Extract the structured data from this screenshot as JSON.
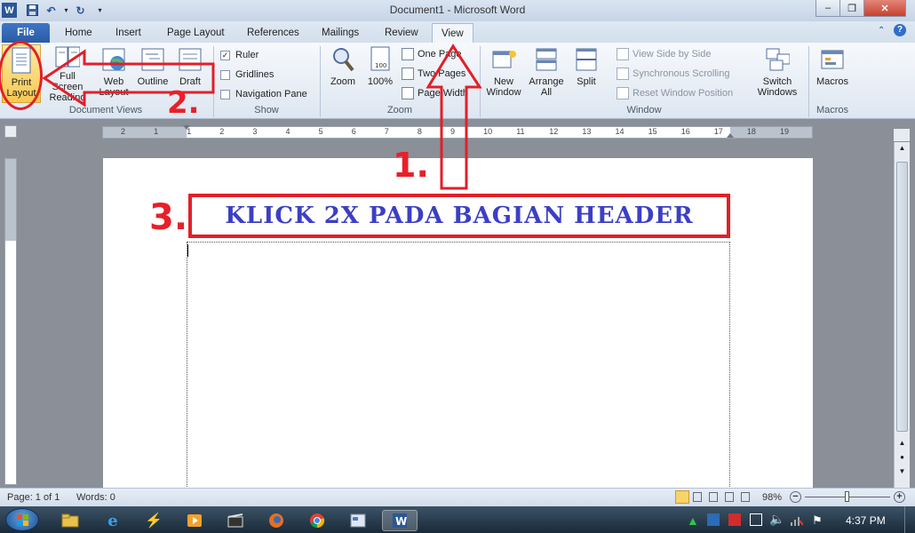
{
  "window": {
    "title": "Document1  -  Microsoft Word",
    "minimize": "–",
    "maximize": "❐",
    "close": "✕"
  },
  "tabs": [
    "File",
    "Home",
    "Insert",
    "Page Layout",
    "References",
    "Mailings",
    "Review",
    "View"
  ],
  "ribbon": {
    "document_views": {
      "label": "Document Views",
      "print_layout": "Print Layout",
      "full_screen": "Full Screen Reading",
      "web_layout": "Web Layout",
      "outline": "Outline",
      "draft": "Draft"
    },
    "show": {
      "label": "Show",
      "ruler": "Ruler",
      "gridlines": "Gridlines",
      "navigation_pane": "Navigation Pane"
    },
    "zoom": {
      "label": "Zoom",
      "zoom": "Zoom",
      "hundred": "100%",
      "one_page": "One Page",
      "two_pages": "Two Pages",
      "page_width": "Page Width"
    },
    "window": {
      "label": "Window",
      "new_window": "New Window",
      "arrange_all": "Arrange All",
      "split": "Split",
      "view_side_by_side": "View Side by Side",
      "sync_scrolling": "Synchronous Scrolling",
      "reset_position": "Reset Window Position",
      "switch_windows": "Switch Windows"
    },
    "macros": {
      "label": "Macros",
      "macros": "Macros"
    }
  },
  "ruler_numbers": [
    "2",
    "1",
    "1",
    "2",
    "3",
    "4",
    "5",
    "6",
    "7",
    "8",
    "9",
    "10",
    "11",
    "12",
    "13",
    "14",
    "15",
    "16",
    "17",
    "18",
    "19"
  ],
  "annotations": {
    "step1": "1.",
    "step2": "2.",
    "step3": "3.",
    "instruction": "KLICK 2X PADA BAGIAN HEADER"
  },
  "status": {
    "page": "Page: 1 of 1",
    "words": "Words: 0",
    "zoom": "98%"
  },
  "taskbar": {
    "clock": "4:37 PM"
  },
  "colors": {
    "annotation_red": "#e21f28",
    "instruction_blue": "#3c3fc4",
    "file_tab": "#2a5aa5"
  }
}
